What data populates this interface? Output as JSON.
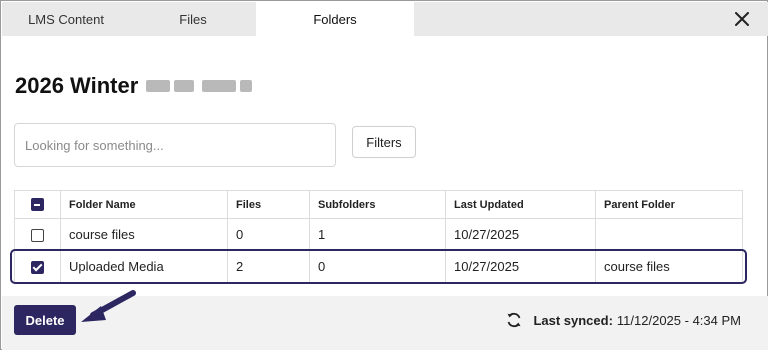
{
  "tabs": [
    {
      "label": "LMS Content"
    },
    {
      "label": "Files"
    },
    {
      "label": "Folders"
    }
  ],
  "title": "2026 Winter",
  "search": {
    "placeholder": "Looking for something...",
    "value": ""
  },
  "filters_label": "Filters",
  "table": {
    "headers": {
      "name": "Folder Name",
      "files": "Files",
      "subfolders": "Subfolders",
      "updated": "Last Updated",
      "parent": "Parent Folder"
    },
    "rows": [
      {
        "name": "course files",
        "files": "0",
        "subfolders": "1",
        "updated": "10/27/2025",
        "parent": "",
        "checked": false
      },
      {
        "name": "Uploaded Media",
        "files": "2",
        "subfolders": "0",
        "updated": "10/27/2025",
        "parent": "course files",
        "checked": true
      }
    ]
  },
  "delete_label": "Delete",
  "sync": {
    "label": "Last synced:",
    "value": "11/12/2025 - 4:34 PM"
  },
  "colors": {
    "accent": "#2c2760",
    "tabbar": "#e9e9e9",
    "footer": "#f2f2f2"
  }
}
